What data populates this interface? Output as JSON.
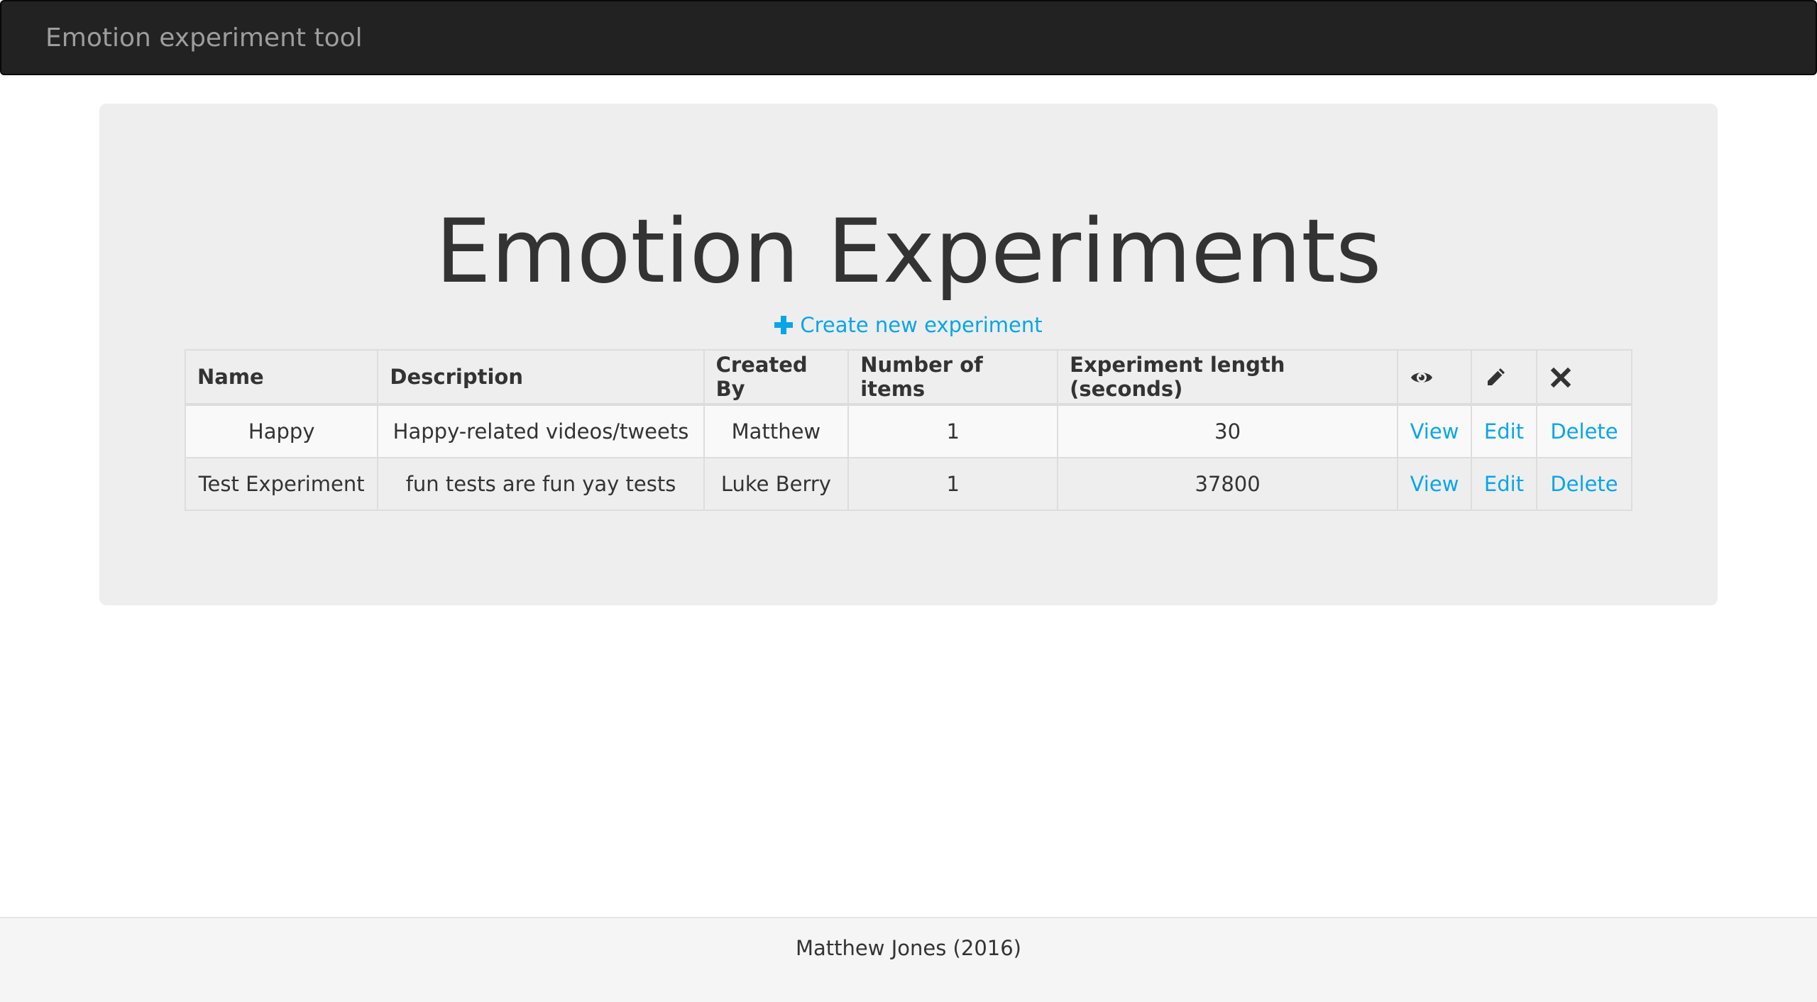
{
  "navbar": {
    "brand": "Emotion experiment tool"
  },
  "main": {
    "title": "Emotion Experiments",
    "create_link_label": "Create new experiment",
    "table": {
      "headers": {
        "name": "Name",
        "description": "Description",
        "created_by": "Created By",
        "items": "Number of items",
        "length": "Experiment length (seconds)"
      },
      "header_icons": [
        "eye-icon",
        "pencil-icon",
        "remove-icon"
      ],
      "rows": [
        {
          "name": "Happy",
          "description": "Happy-related videos/tweets",
          "created_by": "Matthew",
          "items": "1",
          "length": "30",
          "view": "View",
          "edit": "Edit",
          "delete": "Delete"
        },
        {
          "name": "Test Experiment",
          "description": "fun tests are fun yay tests",
          "created_by": "Luke Berry",
          "items": "1",
          "length": "37800",
          "view": "View",
          "edit": "Edit",
          "delete": "Delete"
        }
      ]
    }
  },
  "footer": {
    "text": "Matthew Jones (2016)"
  },
  "colors": {
    "link": "#0aa5e8",
    "navbar_bg": "#222222",
    "navbar_text": "#9d9d9d",
    "jumbotron_bg": "#eeeeee",
    "footer_bg": "#f5f5f5"
  }
}
